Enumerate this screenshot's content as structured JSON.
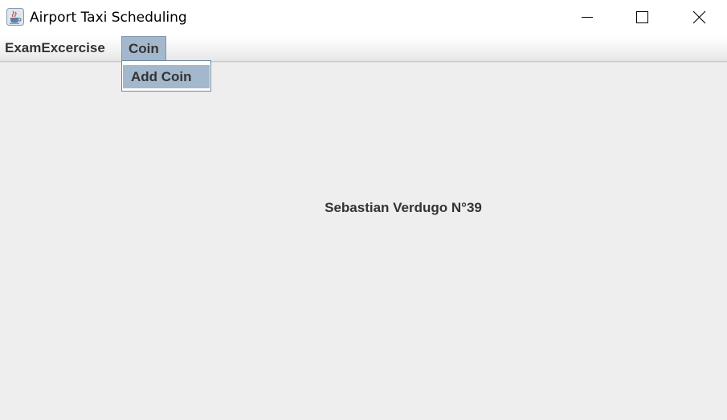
{
  "window": {
    "title": "Airport Taxi Scheduling",
    "icon": "java-cup-icon"
  },
  "menubar": {
    "items": [
      {
        "label": "ExamExcercise"
      },
      {
        "label": "Coin"
      }
    ]
  },
  "popup": {
    "items": [
      {
        "label": "Add Coin"
      }
    ]
  },
  "content": {
    "label": "Sebastian Verdugo N°39"
  },
  "colors": {
    "menu_selected": "#a3b8cc",
    "background": "#eeeeee",
    "text": "#333333"
  }
}
